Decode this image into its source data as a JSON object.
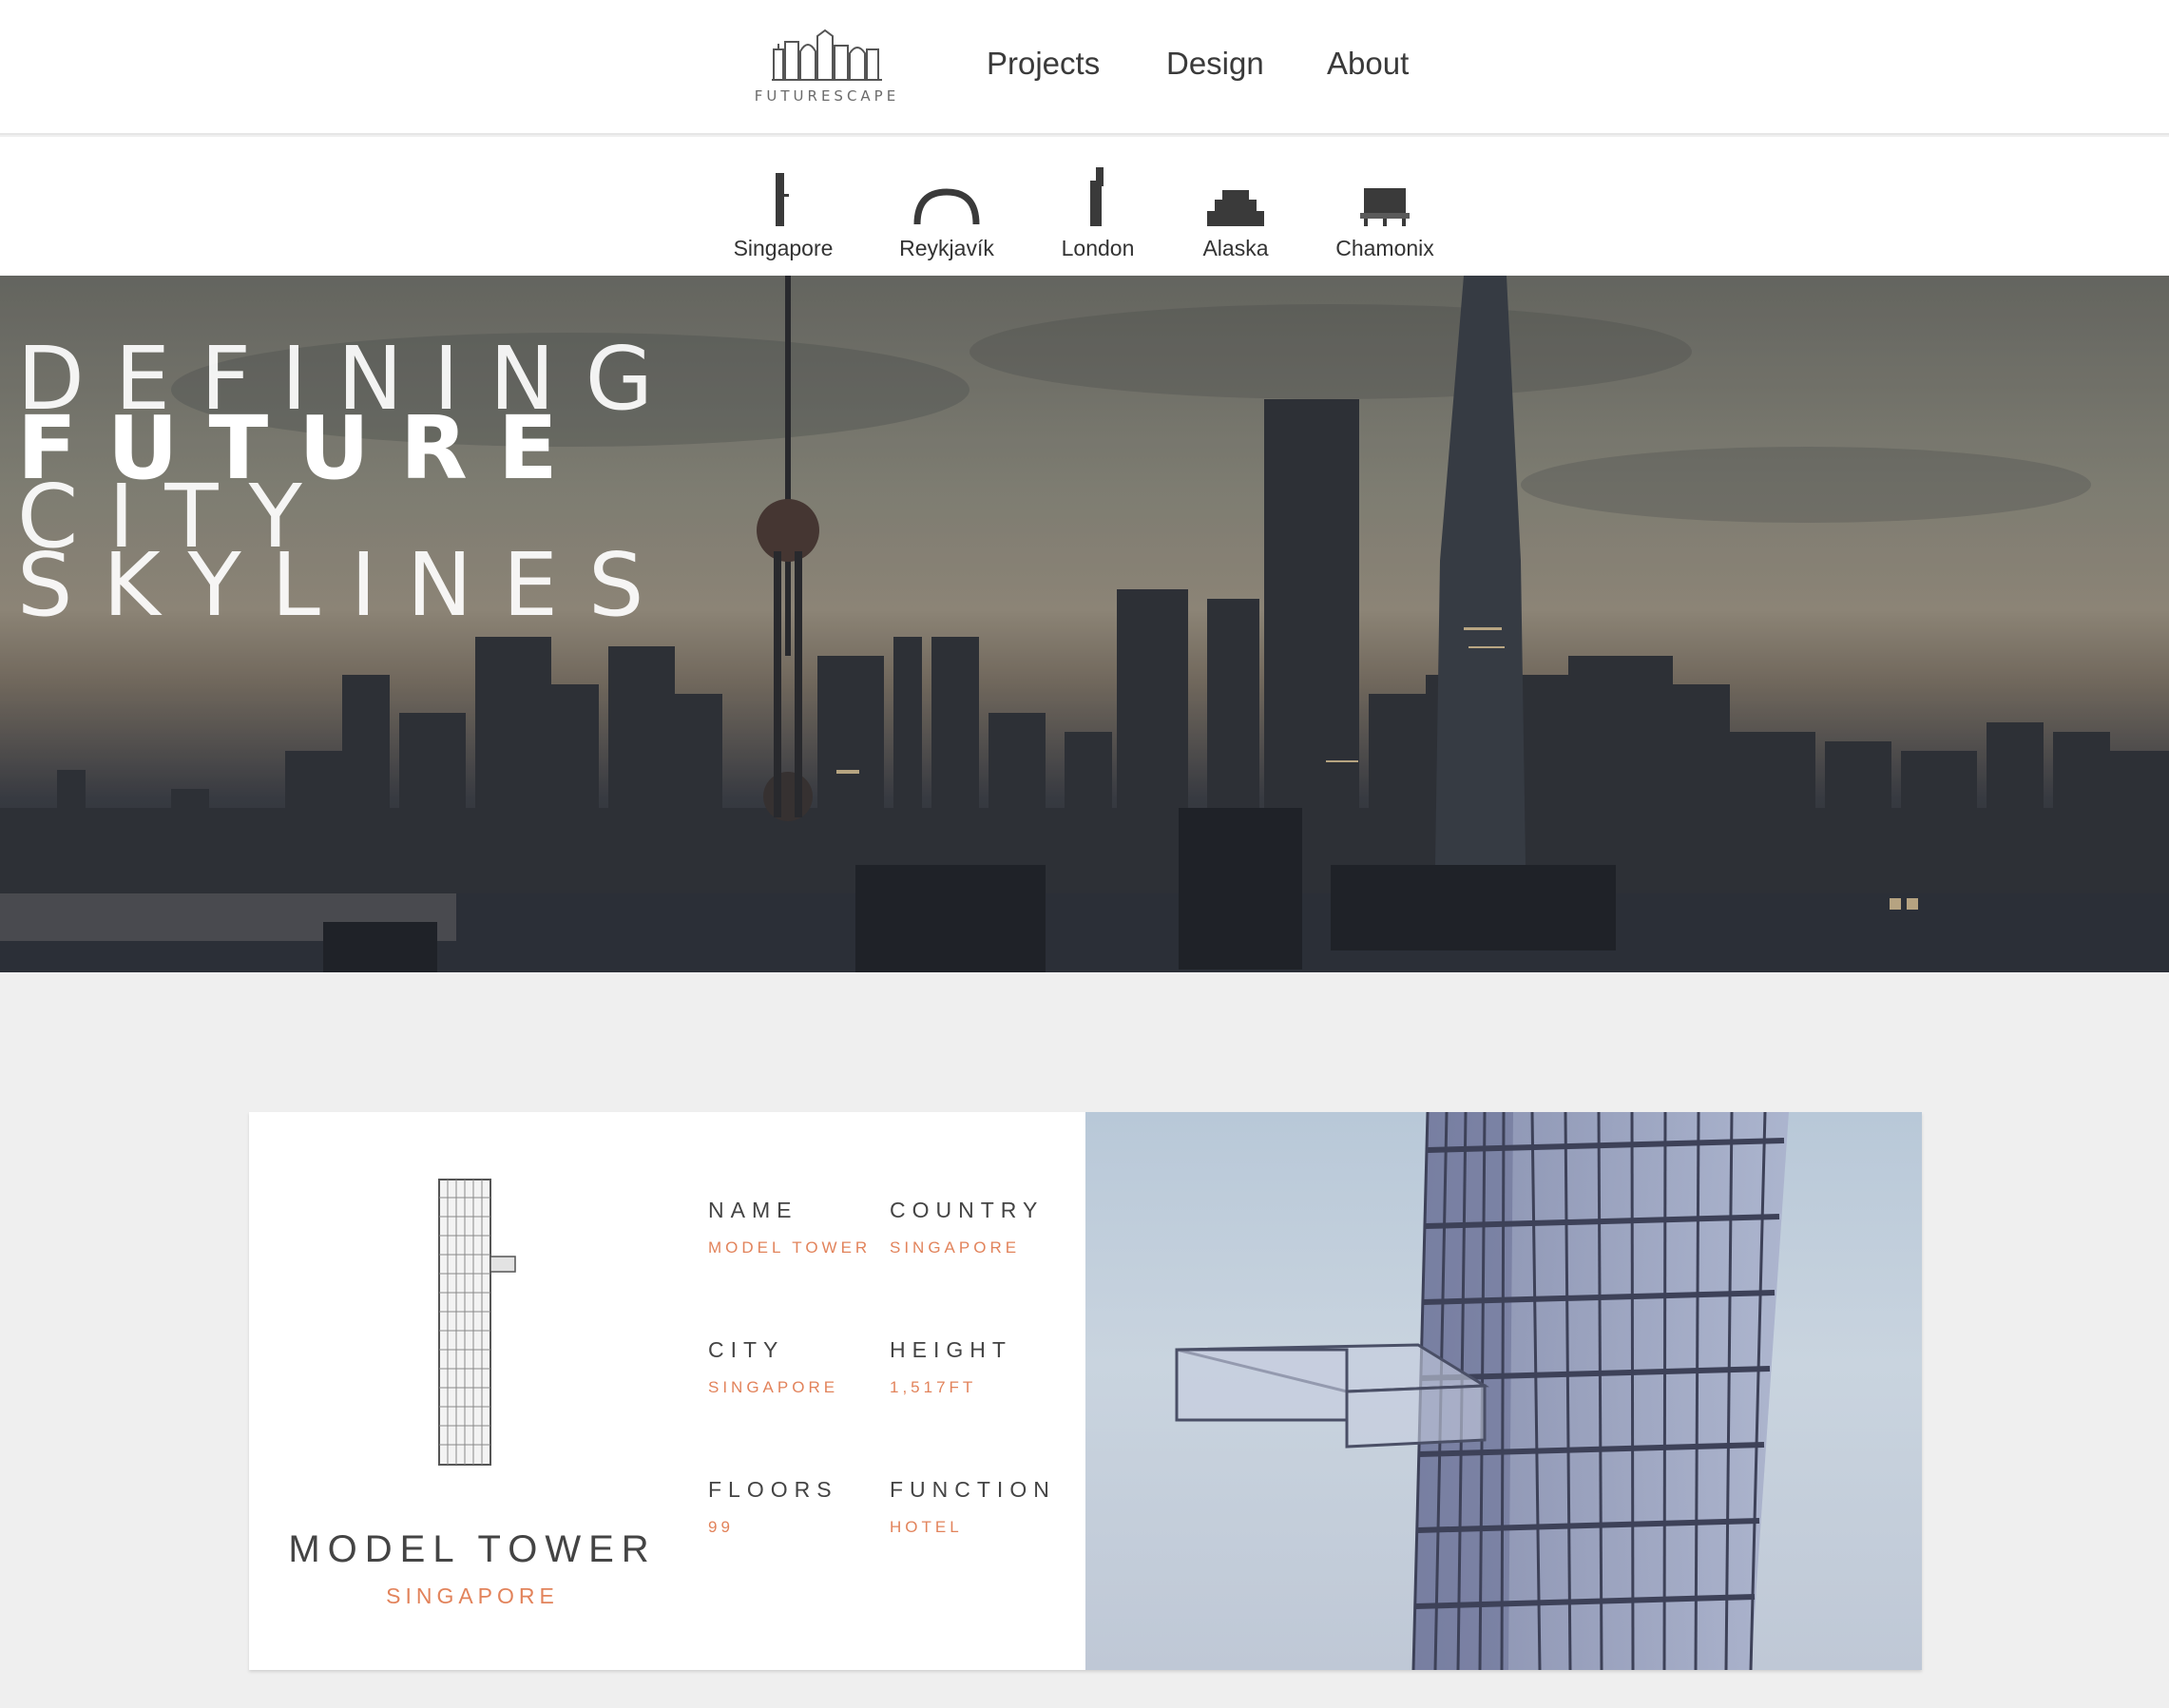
{
  "brand": {
    "name": "FUTURESCAPE",
    "logo_icon": "city-skyline-logo-icon"
  },
  "nav": {
    "links": [
      "Projects",
      "Design",
      "About"
    ]
  },
  "projects": [
    {
      "label": "Singapore",
      "icon": "slim-tower-icon"
    },
    {
      "label": "Reykjavík",
      "icon": "arch-icon"
    },
    {
      "label": "London",
      "icon": "stepped-tower-icon"
    },
    {
      "label": "Alaska",
      "icon": "stacked-block-icon"
    },
    {
      "label": "Chamonix",
      "icon": "cantilever-block-icon"
    }
  ],
  "hero": {
    "lines": [
      "DEFINING",
      "FUTURE",
      "CITY",
      "SKYLINES"
    ]
  },
  "card": {
    "title": "MODEL TOWER",
    "subtitle": "SINGAPORE",
    "specs": [
      {
        "label": "NAME",
        "value": "MODEL TOWER"
      },
      {
        "label": "COUNTRY",
        "value": "SINGAPORE"
      },
      {
        "label": "CITY",
        "value": "SINGAPORE"
      },
      {
        "label": "HEIGHT",
        "value": "1,517FT"
      },
      {
        "label": "FLOORS",
        "value": "99"
      },
      {
        "label": "FUNCTION",
        "value": "HOTEL"
      }
    ]
  },
  "colors": {
    "accent": "#e2835b",
    "text": "#444444",
    "page_bg": "#efefef"
  }
}
